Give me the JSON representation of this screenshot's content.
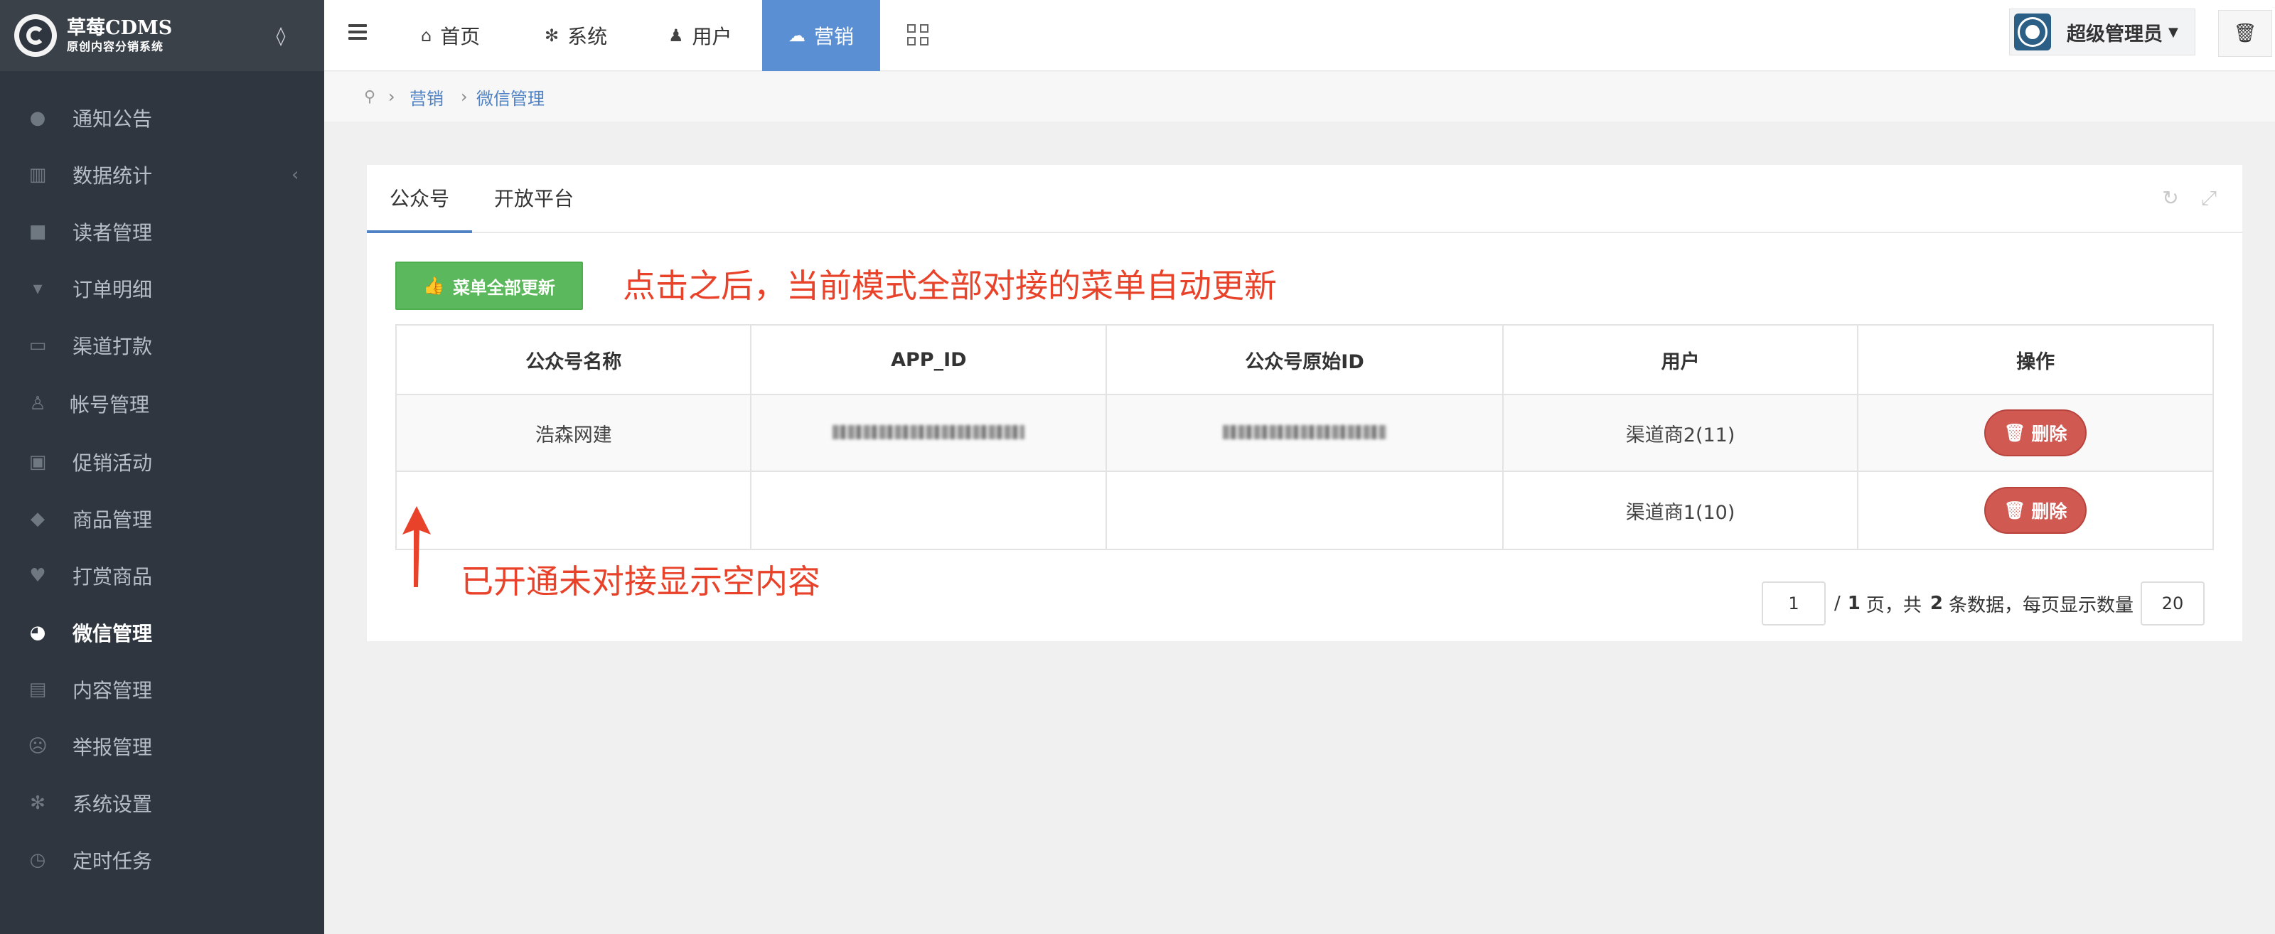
{
  "brand": {
    "title": "草莓CDMS",
    "subtitle": "原创内容分销系统"
  },
  "sidebar": {
    "items": [
      {
        "label": "通知公告",
        "icon": "chat-bubble-icon"
      },
      {
        "label": "数据统计",
        "icon": "bar-chart-icon"
      },
      {
        "label": "读者管理",
        "icon": "user-lock-icon"
      },
      {
        "label": "订单明细",
        "icon": "cart-icon"
      },
      {
        "label": "渠道打款",
        "icon": "card-icon"
      },
      {
        "label": "帐号管理",
        "icon": "user-icon"
      },
      {
        "label": "促销活动",
        "icon": "briefcase-icon"
      },
      {
        "label": "商品管理",
        "icon": "diamond-icon"
      },
      {
        "label": "打赏商品",
        "icon": "heart-icon"
      },
      {
        "label": "微信管理",
        "icon": "wechat-icon"
      },
      {
        "label": "内容管理",
        "icon": "book-icon"
      },
      {
        "label": "举报管理",
        "icon": "frown-icon"
      },
      {
        "label": "系统设置",
        "icon": "gear-icon"
      },
      {
        "label": "定时任务",
        "icon": "clock-icon"
      }
    ],
    "active": "微信管理"
  },
  "topnav": {
    "items": [
      {
        "label": "首页",
        "icon": "home-icon"
      },
      {
        "label": "系统",
        "icon": "gear-icon"
      },
      {
        "label": "用户",
        "icon": "user-icon"
      },
      {
        "label": "营销",
        "icon": "cloud-icon"
      }
    ],
    "active": "营销",
    "user": "超级管理员"
  },
  "breadcrumb": [
    "营销",
    "微信管理"
  ],
  "tabs": [
    "公众号",
    "开放平台"
  ],
  "update_button": "菜单全部更新",
  "annotations": {
    "top": "点击之后，当前模式全部对接的菜单自动更新",
    "bottom": "已开通未对接显示空内容"
  },
  "table": {
    "headers": [
      "公众号名称",
      "APP_ID",
      "公众号原始ID",
      "用户",
      "操作"
    ],
    "rows": [
      {
        "name": "浩森网建",
        "user": "渠道商2(11)",
        "action": "删除"
      },
      {
        "name": "",
        "user": "渠道商1(10)",
        "action": "删除"
      }
    ]
  },
  "pagination": {
    "page": "1",
    "total_pages": "1",
    "page_suffix": "页，共",
    "total_records": "2",
    "records_text": "条数据，每页显示数量",
    "page_size": "20"
  },
  "colors": {
    "sidebar": "#2f3640",
    "accent": "#5b8fd4",
    "success": "#5cb85c",
    "danger": "#d05a52",
    "annotation": "#e8432a"
  }
}
